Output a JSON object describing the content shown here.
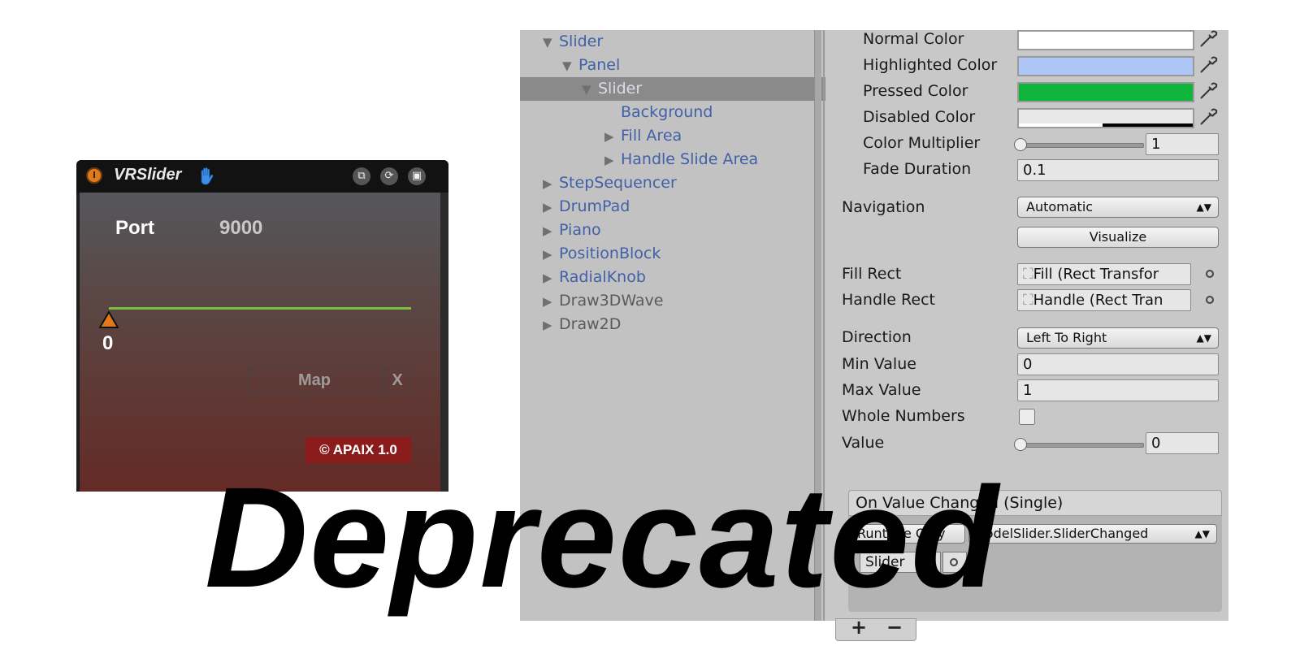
{
  "device": {
    "title": "VRSlider",
    "port_label": "Port",
    "port_value": "9000",
    "slider_value": "0",
    "map_label": "Map",
    "x_label": "X",
    "badge": "© APAIX 1.0",
    "accent_color": "#7ac143",
    "badge_color": "#8b1c1c",
    "icons": [
      "power-icon",
      "hand-icon",
      "fit-window-icon",
      "refresh-icon",
      "save-icon"
    ]
  },
  "hierarchy": {
    "items": [
      {
        "label": "Slider",
        "expanded": true
      },
      {
        "label": "Panel",
        "expanded": true
      },
      {
        "label": "Slider",
        "expanded": true,
        "selected": true
      },
      {
        "label": "Background"
      },
      {
        "label": "Fill Area",
        "collapsed": true
      },
      {
        "label": "Handle Slide Area",
        "collapsed": true
      },
      {
        "label": "StepSequencer",
        "collapsed": true
      },
      {
        "label": "DrumPad",
        "collapsed": true
      },
      {
        "label": "Piano",
        "collapsed": true
      },
      {
        "label": "PositionBlock",
        "collapsed": true
      },
      {
        "label": "RadialKnob",
        "collapsed": true
      },
      {
        "label": "Draw3DWave",
        "collapsed": true
      },
      {
        "label": "Draw2D",
        "collapsed": true
      }
    ]
  },
  "inspector": {
    "normal_color": {
      "label": "Normal Color",
      "color": "#ffffff"
    },
    "highlighted_color": {
      "label": "Highlighted Color",
      "color": "#adc6f5"
    },
    "pressed_color": {
      "label": "Pressed Color",
      "color": "#0fb53a"
    },
    "disabled_color": {
      "label": "Disabled Color",
      "color": "#e8e8e8"
    },
    "color_multiplier": {
      "label": "Color Multiplier",
      "value": "1"
    },
    "fade_duration": {
      "label": "Fade Duration",
      "value": "0.1"
    },
    "navigation": {
      "label": "Navigation",
      "value": "Automatic"
    },
    "visualize": "Visualize",
    "fill_rect": {
      "label": "Fill Rect",
      "value": "Fill (Rect Transfor"
    },
    "handle_rect": {
      "label": "Handle Rect",
      "value": "Handle (Rect Tran"
    },
    "direction": {
      "label": "Direction",
      "value": "Left To Right"
    },
    "min_value": {
      "label": "Min Value",
      "value": "0"
    },
    "max_value": {
      "label": "Max Value",
      "value": "1"
    },
    "whole_numbers": {
      "label": "Whole Numbers",
      "checked": false
    },
    "value": {
      "label": "Value",
      "value": "0"
    },
    "event_header": "On Value Changed (Single)",
    "runtime_dd": "Runtime Only",
    "function_dd": "ModelSlider.SliderChanged",
    "object_field": "Slider",
    "plus": "+",
    "minus": "−"
  },
  "watermark": "Deprecated"
}
